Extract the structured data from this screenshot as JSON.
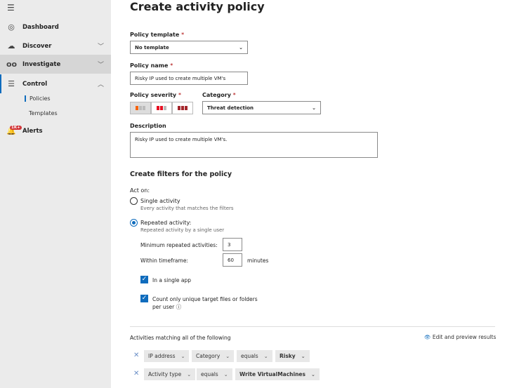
{
  "sidebar": {
    "items": [
      {
        "label": "Dashboard",
        "icon": "gauge-icon"
      },
      {
        "label": "Discover",
        "icon": "cloud-icon"
      },
      {
        "label": "Investigate",
        "icon": "glasses-icon"
      },
      {
        "label": "Control",
        "icon": "sliders-icon"
      }
    ],
    "sub_items": [
      "Policies",
      "Templates"
    ],
    "alerts": {
      "label": "Alerts",
      "badge": "1K+"
    }
  },
  "page": {
    "title": "Create activity policy"
  },
  "form": {
    "template_label": "Policy template",
    "template_value": "No template",
    "name_label": "Policy name",
    "name_value": "Risky IP used to create multiple VM's",
    "severity_label": "Policy severity",
    "category_label": "Category",
    "category_value": "Threat detection",
    "description_label": "Description",
    "description_value": "Risky IP used to create multiple VM's.",
    "required_mark": "*"
  },
  "filters": {
    "heading": "Create filters for the policy",
    "act_on": "Act on:",
    "single_label": "Single activity",
    "single_desc": "Every activity that matches the filters",
    "repeated_label": "Repeated activity:",
    "repeated_desc": "Repeated activity by a single user",
    "min_label": "Minimum repeated activities:",
    "min_value": "3",
    "within_label": "Within timeframe:",
    "within_value": "60",
    "minutes": "minutes",
    "single_app": "In a single app",
    "unique_line1": "Count only unique target files or folders",
    "unique_line2": "per user",
    "matching": "Activities matching all of the following",
    "edit_preview": "Edit and preview results",
    "row1": [
      "IP address",
      "Category",
      "equals",
      "Risky"
    ],
    "row2": [
      "Activity type",
      "equals",
      "Write VirtualMachines"
    ]
  },
  "colors": {
    "accent": "#0f6cbd",
    "sidebar": "#ebebeb",
    "selected": "#d6d6d6"
  }
}
